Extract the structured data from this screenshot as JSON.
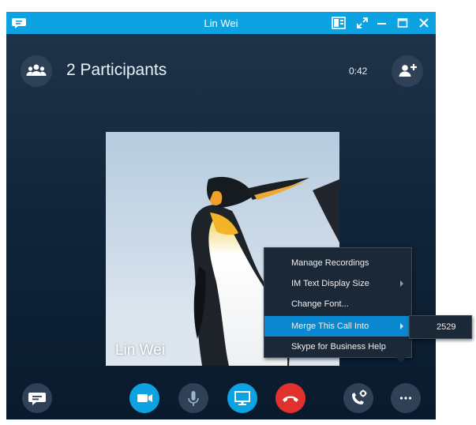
{
  "window": {
    "title": "Lin Wei",
    "accent_color": "#0da2e2"
  },
  "titlebar": {
    "icons": [
      "chat-bubble-icon",
      "layout-icon",
      "fullscreen-icon",
      "minimize-icon",
      "maximize-icon",
      "close-icon"
    ]
  },
  "header": {
    "participants_label": "2 Participants",
    "timer": "0:42",
    "icons": [
      "participants-icon",
      "add-participant-icon"
    ]
  },
  "video": {
    "name": "Lin Wei",
    "subject": "penguin-photo"
  },
  "controls": {
    "buttons": [
      {
        "name": "im-button",
        "icon": "chat-bubble-icon",
        "color": "#2f4156"
      },
      {
        "name": "video-button",
        "icon": "video-camera-icon",
        "color": "#0da2e2"
      },
      {
        "name": "mute-button",
        "icon": "microphone-icon",
        "color": "#2f4156"
      },
      {
        "name": "share-screen-button",
        "icon": "monitor-icon",
        "color": "#0da2e2"
      },
      {
        "name": "hang-up-button",
        "icon": "phone-hangup-icon",
        "color": "#e0312d"
      },
      {
        "name": "call-controls-button",
        "icon": "phone-settings-icon",
        "color": "#2f4156"
      },
      {
        "name": "more-options-button",
        "icon": "ellipsis-icon",
        "color": "#2f4156"
      }
    ]
  },
  "more_menu": {
    "items": [
      {
        "label": "Manage Recordings",
        "has_submenu": false,
        "highlighted": false
      },
      {
        "label": "IM Text Display Size",
        "has_submenu": true,
        "highlighted": false
      },
      {
        "label": "Change Font...",
        "has_submenu": false,
        "highlighted": false
      },
      {
        "label": "Merge This Call Into",
        "has_submenu": true,
        "highlighted": true
      },
      {
        "label": "Skype for Business Help",
        "has_submenu": false,
        "highlighted": false
      }
    ],
    "highlight_color": "#0a87ce"
  },
  "merge_submenu": {
    "items": [
      {
        "label": "2529"
      }
    ]
  }
}
